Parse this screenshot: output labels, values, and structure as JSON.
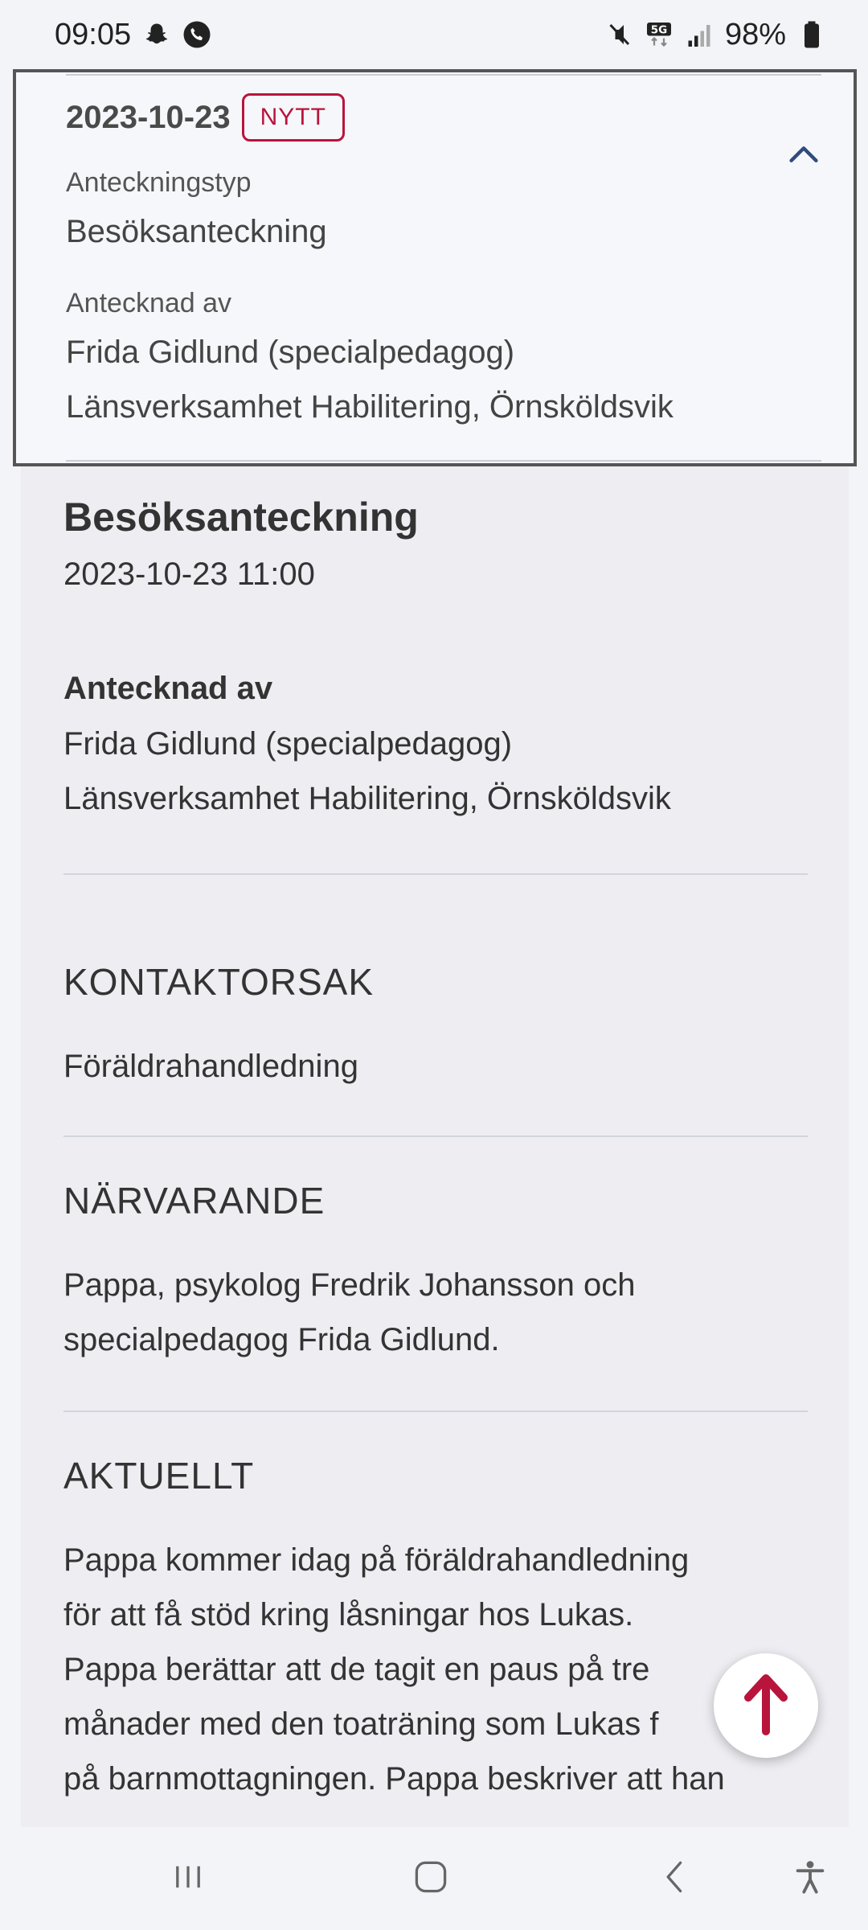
{
  "status_bar": {
    "time": "09:05",
    "battery": "98%",
    "network_badge": "5G",
    "icons_left": [
      "snapchat-icon",
      "phone-call-icon"
    ],
    "icons_right": [
      "mute-icon",
      "5g-icon",
      "signal-icon",
      "battery-icon"
    ]
  },
  "note_header": {
    "date": "2023-10-23",
    "badge": "NYTT",
    "type_label": "Anteckningstyp",
    "type_value": "Besöksanteckning",
    "by_label": "Antecknad av",
    "by_name": "Frida Gidlund (specialpedagog)",
    "by_unit": "Länsverksamhet Habilitering, Örnsköldsvik"
  },
  "note": {
    "title": "Besöksanteckning",
    "datetime": "2023-10-23 11:00",
    "by_label": "Antecknad av",
    "by_name": "Frida Gidlund (specialpedagog)",
    "by_unit": "Länsverksamhet Habilitering, Örnsköldsvik"
  },
  "sections": {
    "kontaktorsak": {
      "heading": "KONTAKTORSAK",
      "text": "Föräldrahandledning"
    },
    "narvarande": {
      "heading": "NÄRVARANDE",
      "line1": "Pappa, psykolog Fredrik Johansson och",
      "line2": "specialpedagog Frida Gidlund."
    },
    "aktuellt": {
      "heading": "AKTUELLT",
      "line1": "Pappa kommer idag på föräldrahandledning",
      "line2": "för att få stöd kring låsningar hos Lukas.",
      "line3": "Pappa berättar att de tagit en paus på tre",
      "line4": "månader med den toaträning som Lukas f",
      "line5": "på barnmottagningen. Pappa beskriver att han"
    }
  },
  "colors": {
    "accent": "#b8143c",
    "chevron": "#2f4b7c",
    "background": "#ededf2"
  },
  "nav_bar": {
    "buttons": [
      "recent-apps-icon",
      "home-icon",
      "back-icon",
      "accessibility-icon"
    ]
  }
}
